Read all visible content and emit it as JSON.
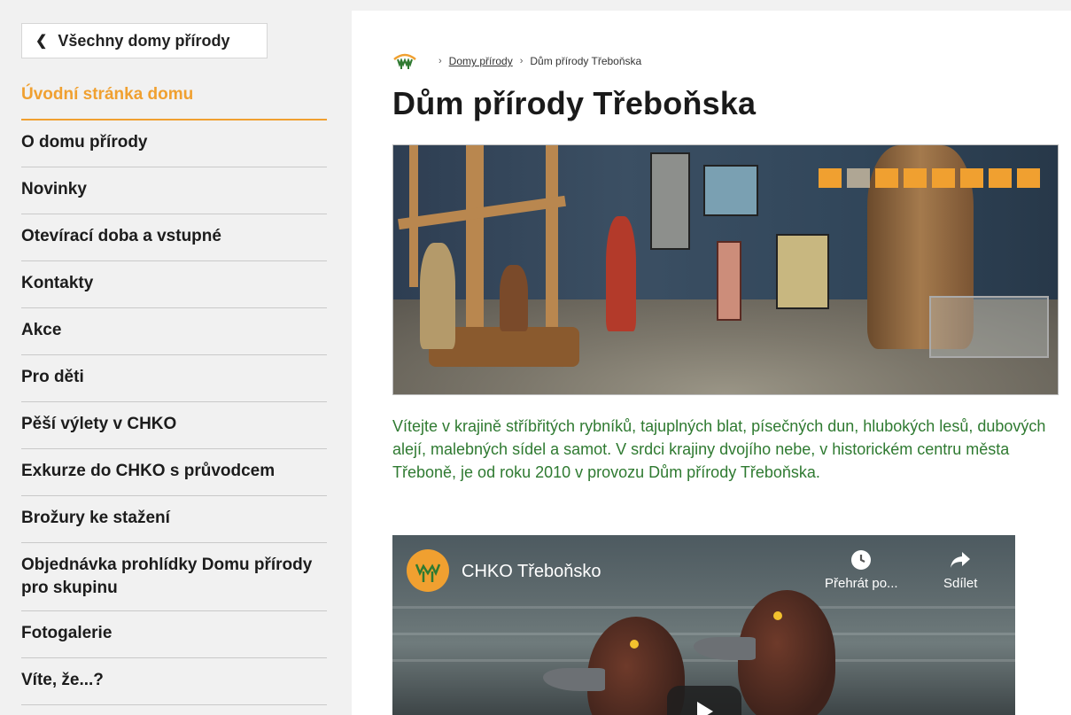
{
  "sidebar": {
    "back_label": "Všechny domy přírody",
    "items": [
      {
        "label": "Úvodní stránka domu",
        "active": true
      },
      {
        "label": "O domu přírody"
      },
      {
        "label": "Novinky"
      },
      {
        "label": "Otevírací doba a vstupné"
      },
      {
        "label": "Kontakty"
      },
      {
        "label": "Akce"
      },
      {
        "label": "Pro děti"
      },
      {
        "label": "Pěší výlety v CHKO"
      },
      {
        "label": "Exkurze do CHKO s průvodcem"
      },
      {
        "label": "Brožury ke stažení"
      },
      {
        "label": "Objednávka prohlídky Domu přírody pro skupinu"
      },
      {
        "label": "Fotogalerie"
      },
      {
        "label": "Víte, že...?"
      }
    ]
  },
  "breadcrumb": {
    "separator": "›",
    "link": "Domy přírody",
    "current": "Dům přírody Třeboňska"
  },
  "page": {
    "title": "Dům přírody Třeboňska",
    "intro": "Vítejte v krajině stříbřitých rybníků, tajuplných blat, písečných dun, hlubokých lesů, dubových alejí, malebných sídel a samot. V srdci krajiny dvojího nebe, v historickém centru města Třeboně, je od roku 2010 v provozu Dům přírody Třeboňska."
  },
  "slider": {
    "count": 8,
    "active_index": 1
  },
  "video": {
    "channel": "CHKO Třeboňsko",
    "watch_later_label": "Přehrát po...",
    "share_label": "Sdílet"
  },
  "colors": {
    "accent": "#f0a030",
    "intro_text": "#2f7a31"
  }
}
